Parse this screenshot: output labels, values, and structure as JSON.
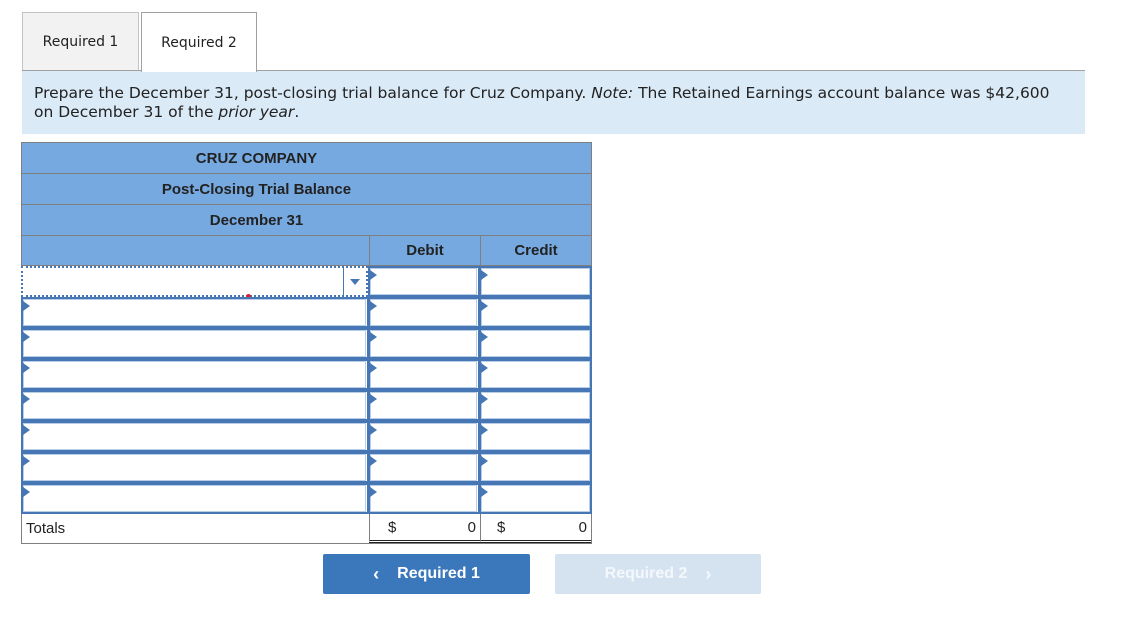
{
  "tabs": [
    {
      "label": "Required 1",
      "active": false
    },
    {
      "label": "Required 2",
      "active": true
    }
  ],
  "instructions": {
    "part1": "Prepare the December 31, post-closing trial balance for Cruz Company. ",
    "note_label": "Note:",
    "part2": " The Retained Earnings account balance was $42,600 on December 31 of the ",
    "emphasis": "prior year",
    "part3": "."
  },
  "statement": {
    "company": "CRUZ COMPANY",
    "title": "Post-Closing Trial Balance",
    "date": "December 31",
    "columns": {
      "account": "",
      "debit": "Debit",
      "credit": "Credit"
    },
    "rows": [
      {
        "account": "",
        "debit": "",
        "credit": ""
      },
      {
        "account": "",
        "debit": "",
        "credit": ""
      },
      {
        "account": "",
        "debit": "",
        "credit": ""
      },
      {
        "account": "",
        "debit": "",
        "credit": ""
      },
      {
        "account": "",
        "debit": "",
        "credit": ""
      },
      {
        "account": "",
        "debit": "",
        "credit": ""
      },
      {
        "account": "",
        "debit": "",
        "credit": ""
      },
      {
        "account": "",
        "debit": "",
        "credit": ""
      }
    ],
    "totals": {
      "label": "Totals",
      "debit_currency": "$",
      "debit_value": "0",
      "credit_currency": "$",
      "credit_value": "0"
    }
  },
  "navigation": {
    "prev_label": "Required 1",
    "prev_icon": "‹",
    "next_label": "Required 2",
    "next_icon": "›"
  }
}
